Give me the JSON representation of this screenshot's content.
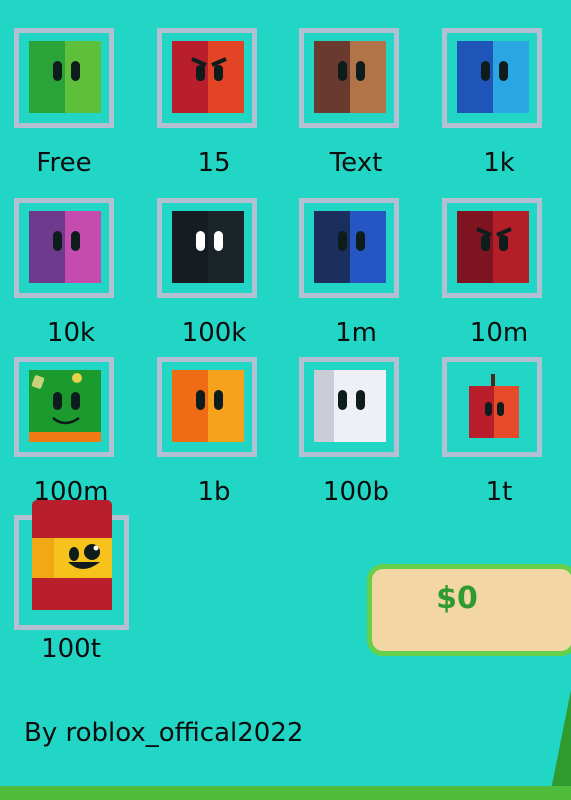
{
  "shop": {
    "items": [
      {
        "label": "Free",
        "skin": "green-block"
      },
      {
        "label": "15",
        "skin": "angry-red-block"
      },
      {
        "label": "Text",
        "skin": "brown-block"
      },
      {
        "label": "1k",
        "skin": "blue-block"
      },
      {
        "label": "10k",
        "skin": "purple-block"
      },
      {
        "label": "100k",
        "skin": "black-block"
      },
      {
        "label": "1m",
        "skin": "navy-block"
      },
      {
        "label": "10m",
        "skin": "angry-darkred-block"
      },
      {
        "label": "100m",
        "skin": "smiling-green-grass-block"
      },
      {
        "label": "1b",
        "skin": "orange-block"
      },
      {
        "label": "100b",
        "skin": "white-block"
      },
      {
        "label": "1t",
        "skin": "apple-block"
      },
      {
        "label": "100t",
        "skin": "spanish-flag-block"
      }
    ]
  },
  "balance": {
    "text": "$0"
  },
  "credit": {
    "text": "By roblox_offical2022"
  },
  "colors": {
    "background": "#22d6c6",
    "slot_border": "#b3bfd3",
    "balance_box": "#f2d6a3",
    "balance_border": "#67d04a",
    "balance_text": "#2f9a2f"
  }
}
